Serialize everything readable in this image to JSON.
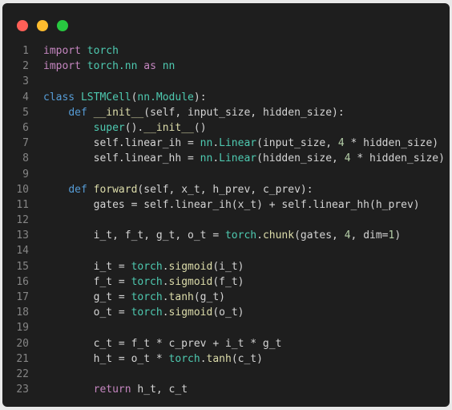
{
  "window": {
    "controls": {
      "close_color": "#ff5f57",
      "minimize_color": "#febc2e",
      "maximize_color": "#28c840"
    }
  },
  "code": {
    "lines": [
      {
        "n": "1",
        "tokens": [
          [
            "kw",
            "import"
          ],
          [
            "id",
            " "
          ],
          [
            "mod",
            "torch"
          ]
        ]
      },
      {
        "n": "2",
        "tokens": [
          [
            "kw",
            "import"
          ],
          [
            "id",
            " "
          ],
          [
            "mod",
            "torch.nn"
          ],
          [
            "id",
            " "
          ],
          [
            "kw",
            "as"
          ],
          [
            "id",
            " "
          ],
          [
            "mod",
            "nn"
          ]
        ]
      },
      {
        "n": "3",
        "tokens": []
      },
      {
        "n": "4",
        "tokens": [
          [
            "kw2",
            "class"
          ],
          [
            "id",
            " "
          ],
          [
            "cls",
            "LSTMCell"
          ],
          [
            "id",
            "("
          ],
          [
            "cls",
            "nn.Module"
          ],
          [
            "id",
            "):"
          ]
        ]
      },
      {
        "n": "5",
        "tokens": [
          [
            "id",
            "    "
          ],
          [
            "kw2",
            "def"
          ],
          [
            "id",
            " "
          ],
          [
            "fn",
            "__init__"
          ],
          [
            "id",
            "(self, input_size, hidden_size):"
          ]
        ]
      },
      {
        "n": "6",
        "tokens": [
          [
            "id",
            "        "
          ],
          [
            "cls",
            "super"
          ],
          [
            "id",
            "()."
          ],
          [
            "fn",
            "__init__"
          ],
          [
            "id",
            "()"
          ]
        ]
      },
      {
        "n": "7",
        "tokens": [
          [
            "id",
            "        self.linear_ih = "
          ],
          [
            "cls",
            "nn"
          ],
          [
            "id",
            "."
          ],
          [
            "cls",
            "Linear"
          ],
          [
            "id",
            "(input_size, "
          ],
          [
            "num",
            "4"
          ],
          [
            "id",
            " * hidden_size)"
          ]
        ]
      },
      {
        "n": "8",
        "tokens": [
          [
            "id",
            "        self.linear_hh = "
          ],
          [
            "cls",
            "nn"
          ],
          [
            "id",
            "."
          ],
          [
            "cls",
            "Linear"
          ],
          [
            "id",
            "(hidden_size, "
          ],
          [
            "num",
            "4"
          ],
          [
            "id",
            " * hidden_size)"
          ]
        ]
      },
      {
        "n": "9",
        "tokens": []
      },
      {
        "n": "10",
        "tokens": [
          [
            "id",
            "    "
          ],
          [
            "kw2",
            "def"
          ],
          [
            "id",
            " "
          ],
          [
            "fn",
            "forward"
          ],
          [
            "id",
            "(self, x_t, h_prev, c_prev):"
          ]
        ]
      },
      {
        "n": "11",
        "tokens": [
          [
            "id",
            "        gates = self.linear_ih(x_t) + self.linear_hh(h_prev)"
          ]
        ]
      },
      {
        "n": "12",
        "tokens": []
      },
      {
        "n": "13",
        "tokens": [
          [
            "id",
            "        i_t, f_t, g_t, o_t = "
          ],
          [
            "mod",
            "torch"
          ],
          [
            "id",
            "."
          ],
          [
            "fn",
            "chunk"
          ],
          [
            "id",
            "(gates, "
          ],
          [
            "num",
            "4"
          ],
          [
            "id",
            ", dim="
          ],
          [
            "num",
            "1"
          ],
          [
            "id",
            ")"
          ]
        ]
      },
      {
        "n": "14",
        "tokens": []
      },
      {
        "n": "15",
        "tokens": [
          [
            "id",
            "        i_t = "
          ],
          [
            "mod",
            "torch"
          ],
          [
            "id",
            "."
          ],
          [
            "fn",
            "sigmoid"
          ],
          [
            "id",
            "(i_t)"
          ]
        ]
      },
      {
        "n": "16",
        "tokens": [
          [
            "id",
            "        f_t = "
          ],
          [
            "mod",
            "torch"
          ],
          [
            "id",
            "."
          ],
          [
            "fn",
            "sigmoid"
          ],
          [
            "id",
            "(f_t)"
          ]
        ]
      },
      {
        "n": "17",
        "tokens": [
          [
            "id",
            "        g_t = "
          ],
          [
            "mod",
            "torch"
          ],
          [
            "id",
            "."
          ],
          [
            "fn",
            "tanh"
          ],
          [
            "id",
            "(g_t)"
          ]
        ]
      },
      {
        "n": "18",
        "tokens": [
          [
            "id",
            "        o_t = "
          ],
          [
            "mod",
            "torch"
          ],
          [
            "id",
            "."
          ],
          [
            "fn",
            "sigmoid"
          ],
          [
            "id",
            "(o_t)"
          ]
        ]
      },
      {
        "n": "19",
        "tokens": []
      },
      {
        "n": "20",
        "tokens": [
          [
            "id",
            "        c_t = f_t * c_prev + i_t * g_t"
          ]
        ]
      },
      {
        "n": "21",
        "tokens": [
          [
            "id",
            "        h_t = o_t * "
          ],
          [
            "mod",
            "torch"
          ],
          [
            "id",
            "."
          ],
          [
            "fn",
            "tanh"
          ],
          [
            "id",
            "(c_t)"
          ]
        ]
      },
      {
        "n": "22",
        "tokens": []
      },
      {
        "n": "23",
        "tokens": [
          [
            "id",
            "        "
          ],
          [
            "kw",
            "return"
          ],
          [
            "id",
            " h_t, c_t"
          ]
        ]
      }
    ]
  }
}
